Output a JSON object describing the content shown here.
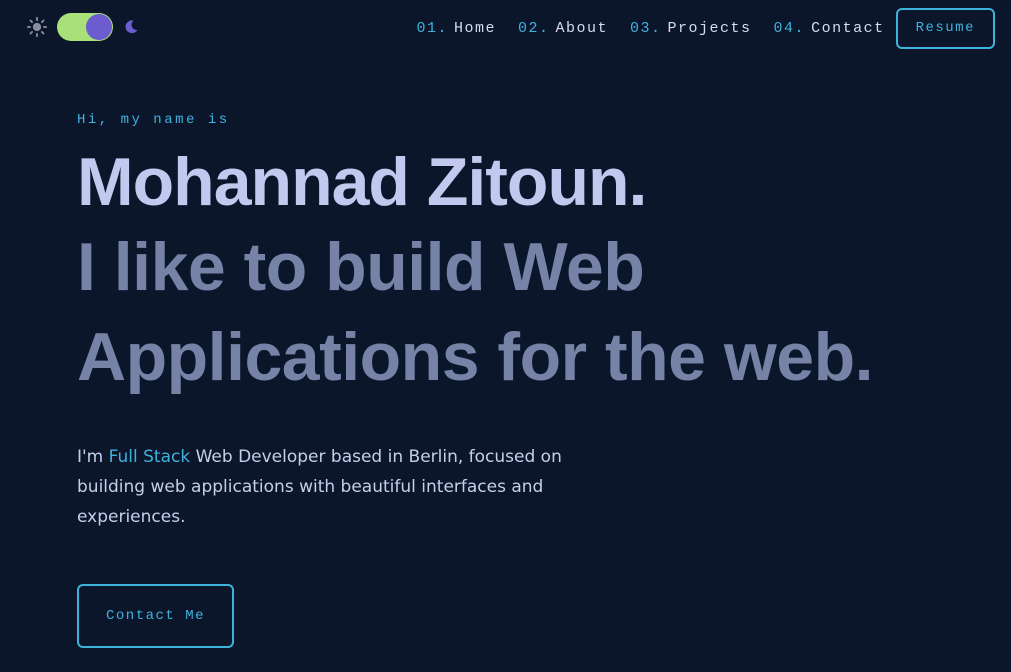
{
  "header": {
    "theme_toggle": {
      "state": "dark",
      "sun_icon": "sun-icon",
      "moon_icon": "moon-icon"
    },
    "nav": [
      {
        "num": "01.",
        "label": "Home"
      },
      {
        "num": "02.",
        "label": "About"
      },
      {
        "num": "03.",
        "label": "Projects"
      },
      {
        "num": "04.",
        "label": "Contact"
      }
    ],
    "resume_label": "Resume"
  },
  "hero": {
    "greeting": "Hi, my name is",
    "name": "Mohannad Zitoun.",
    "tagline_line1": "I like to build Web",
    "tagline_line2": "Applications for the web.",
    "intro": {
      "prefix": "I'm ",
      "highlight": "Full Stack",
      "rest": " Web Developer based in Berlin, focused on building web applications with beautiful interfaces and experiences."
    },
    "contact_label": "Contact Me"
  },
  "colors": {
    "background": "#0b162b",
    "accent": "#3fb2dc",
    "name": "#c3c9ee",
    "tagline": "#7683a6",
    "toggle_track": "#a9e07a",
    "toggle_knob": "#6d5bd0"
  }
}
